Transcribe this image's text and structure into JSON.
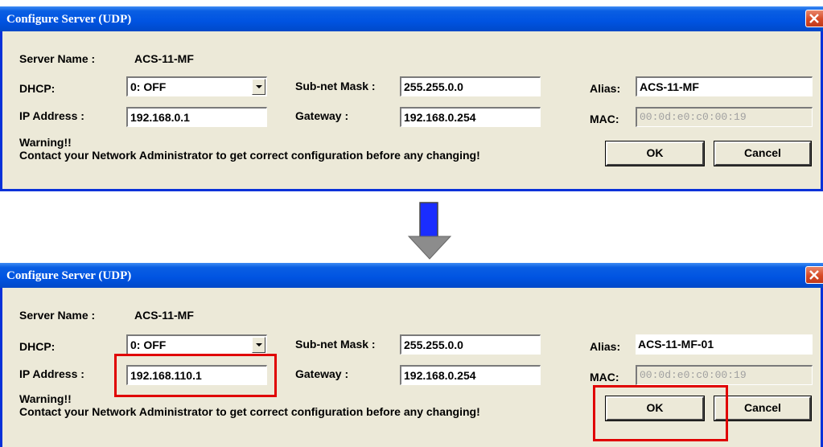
{
  "dialogs": [
    {
      "title": "Configure Server (UDP)",
      "server_name_label": "Server Name :",
      "server_name": "ACS-11-MF",
      "dhcp_label": "DHCP:",
      "dhcp_value": "0: OFF",
      "subnet_label": "Sub-net Mask :",
      "subnet_value": "255.255.0.0",
      "alias_label": "Alias:",
      "alias_value": "ACS-11-MF",
      "ip_label": "IP Address :",
      "ip_value": "192.168.0.1",
      "gateway_label": "Gateway :",
      "gateway_value": "192.168.0.254",
      "mac_label": "MAC:",
      "mac_value": "00:0d:e0:c0:00:19",
      "warning_title": "Warning!!",
      "warning_text": "Contact your Network Administrator to get correct  configuration before any changing!",
      "ok_label": "OK",
      "cancel_label": "Cancel"
    },
    {
      "title": "Configure Server (UDP)",
      "server_name_label": "Server Name :",
      "server_name": "ACS-11-MF",
      "dhcp_label": "DHCP:",
      "dhcp_value": "0: OFF",
      "subnet_label": "Sub-net Mask :",
      "subnet_value": "255.255.0.0",
      "alias_label": "Alias:",
      "alias_value": "ACS-11-MF-01",
      "ip_label": "IP Address :",
      "ip_value": "192.168.110.1",
      "gateway_label": "Gateway :",
      "gateway_value": "192.168.0.254",
      "mac_label": "MAC:",
      "mac_value": "00:0d:e0:c0:00:19",
      "warning_title": "Warning!!",
      "warning_text": "Contact your Network Administrator to get correct  configuration before any changing!",
      "ok_label": "OK",
      "cancel_label": "Cancel"
    }
  ],
  "icons": {
    "close": "close-icon",
    "dropdown": "chevron-down-icon",
    "transition": "arrow-down-icon"
  },
  "colors": {
    "titlebar": "#0053e1",
    "dialog_bg": "#ece9d8",
    "highlight": "#e00000",
    "arrow_fill": "#1a2dff",
    "arrow_head": "#8c8c8c"
  }
}
